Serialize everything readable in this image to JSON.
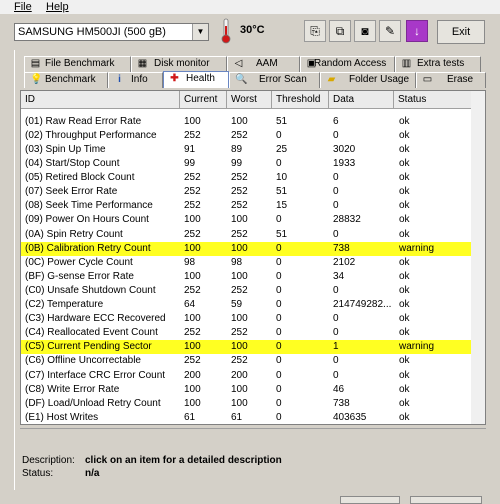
{
  "menu": {
    "file": "File",
    "help": "Help"
  },
  "toolbar": {
    "drive": "SAMSUNG HM500JI (500 gB)",
    "temperature": "30°C",
    "exit_label": "Exit"
  },
  "tabs_row1": [
    {
      "label": "File Benchmark",
      "icon": "file-benchmark-icon"
    },
    {
      "label": "Disk monitor",
      "icon": "disk-monitor-icon"
    },
    {
      "label": "AAM",
      "icon": "aam-speaker-icon"
    },
    {
      "label": "Random Access",
      "icon": "random-access-icon"
    },
    {
      "label": "Extra tests",
      "icon": "extra-tests-icon"
    }
  ],
  "tabs_row2": [
    {
      "label": "Benchmark",
      "icon": "benchmark-icon"
    },
    {
      "label": "Info",
      "icon": "info-icon"
    },
    {
      "label": "Health",
      "icon": "health-cross-icon",
      "active": true
    },
    {
      "label": "Error Scan",
      "icon": "error-scan-icon"
    },
    {
      "label": "Folder Usage",
      "icon": "folder-icon"
    },
    {
      "label": "Erase",
      "icon": "erase-icon"
    }
  ],
  "table": {
    "columns": [
      "ID",
      "Current",
      "Worst",
      "Threshold",
      "Data",
      "Status"
    ],
    "rows": [
      [
        "(01) Raw Read Error Rate",
        "100",
        "100",
        "51",
        "6",
        "ok"
      ],
      [
        "(02) Throughput Performance",
        "252",
        "252",
        "0",
        "0",
        "ok"
      ],
      [
        "(03) Spin Up Time",
        "91",
        "89",
        "25",
        "3020",
        "ok"
      ],
      [
        "(04) Start/Stop Count",
        "99",
        "99",
        "0",
        "1933",
        "ok"
      ],
      [
        "(05) Retired Block Count",
        "252",
        "252",
        "10",
        "0",
        "ok"
      ],
      [
        "(07) Seek Error Rate",
        "252",
        "252",
        "51",
        "0",
        "ok"
      ],
      [
        "(08) Seek Time Performance",
        "252",
        "252",
        "15",
        "0",
        "ok"
      ],
      [
        "(09) Power On Hours Count",
        "100",
        "100",
        "0",
        "28832",
        "ok"
      ],
      [
        "(0A) Spin Retry Count",
        "252",
        "252",
        "51",
        "0",
        "ok"
      ],
      [
        "(0B) Calibration Retry Count",
        "100",
        "100",
        "0",
        "738",
        "warning"
      ],
      [
        "(0C) Power Cycle Count",
        "98",
        "98",
        "0",
        "2102",
        "ok"
      ],
      [
        "(BF) G-sense Error Rate",
        "100",
        "100",
        "0",
        "34",
        "ok"
      ],
      [
        "(C0) Unsafe Shutdown Count",
        "252",
        "252",
        "0",
        "0",
        "ok"
      ],
      [
        "(C2) Temperature",
        "64",
        "59",
        "0",
        "214749282...",
        "ok"
      ],
      [
        "(C3) Hardware ECC Recovered",
        "100",
        "100",
        "0",
        "0",
        "ok"
      ],
      [
        "(C4) Reallocated Event Count",
        "252",
        "252",
        "0",
        "0",
        "ok"
      ],
      [
        "(C5) Current Pending Sector",
        "100",
        "100",
        "0",
        "1",
        "warning"
      ],
      [
        "(C6) Offline Uncorrectable",
        "252",
        "252",
        "0",
        "0",
        "ok"
      ],
      [
        "(C7) Interface CRC Error Count",
        "200",
        "200",
        "0",
        "0",
        "ok"
      ],
      [
        "(C8) Write Error Rate",
        "100",
        "100",
        "0",
        "46",
        "ok"
      ],
      [
        "(DF) Load/Unload Retry Count",
        "100",
        "100",
        "0",
        "738",
        "ok"
      ],
      [
        "(E1) Host Writes",
        "61",
        "61",
        "0",
        "403635",
        "ok"
      ]
    ]
  },
  "description": {
    "desc_label": "Description:",
    "desc_value": "click on an item for a detailed description",
    "status_label": "Status:",
    "status_value": "n/a"
  },
  "colors": {
    "warning_row": "#ffff22",
    "active_tab": "#ffffff",
    "window_bg": "#d4d0c8"
  }
}
